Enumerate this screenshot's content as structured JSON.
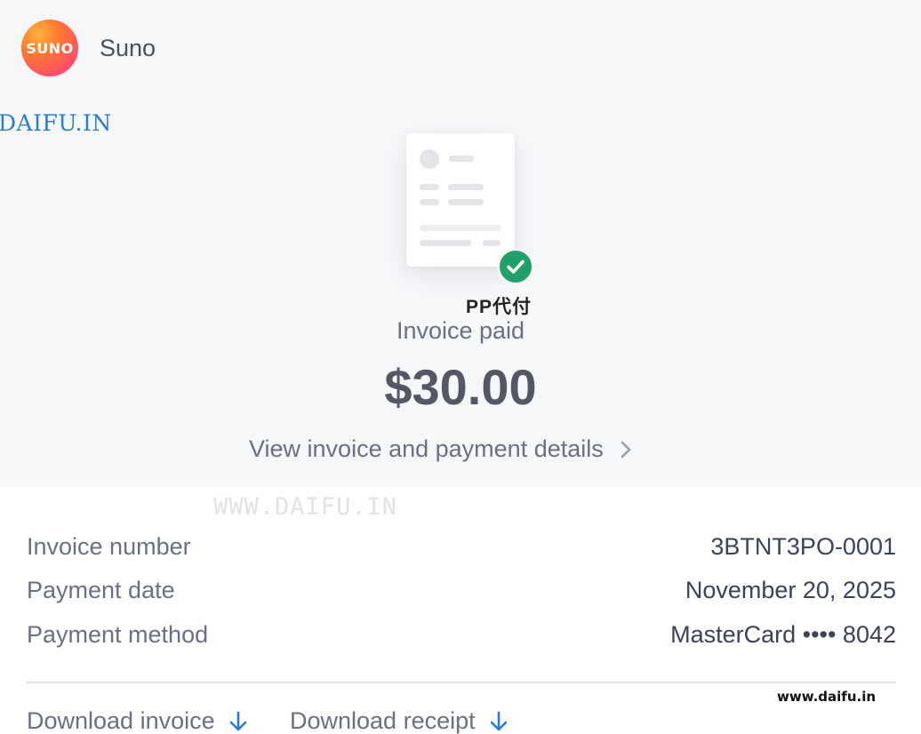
{
  "brand": {
    "logo_text": "SUNO",
    "name": "Suno"
  },
  "watermarks": {
    "top_left": "DAIFU.IN",
    "center_overlay": "PP代付",
    "mid": "WWW.DAIFU.IN",
    "bottom_right": "www.daifu.in"
  },
  "summary": {
    "status": "Invoice paid",
    "amount": "$30.00",
    "details_link": "View invoice and payment details",
    "status_icon": "check-circle-icon"
  },
  "details": {
    "rows": [
      {
        "label": "Invoice number",
        "value": "3BTNT3PO-0001"
      },
      {
        "label": "Payment date",
        "value": "November 20, 2025"
      },
      {
        "label": "Payment method",
        "value": "MasterCard •••• 8042"
      }
    ]
  },
  "actions": {
    "download_invoice": "Download invoice",
    "download_receipt": "Download receipt"
  },
  "colors": {
    "success": "#21a06a",
    "link_arrow": "#2a7bd1",
    "header_bg": "#f6f7f9"
  }
}
